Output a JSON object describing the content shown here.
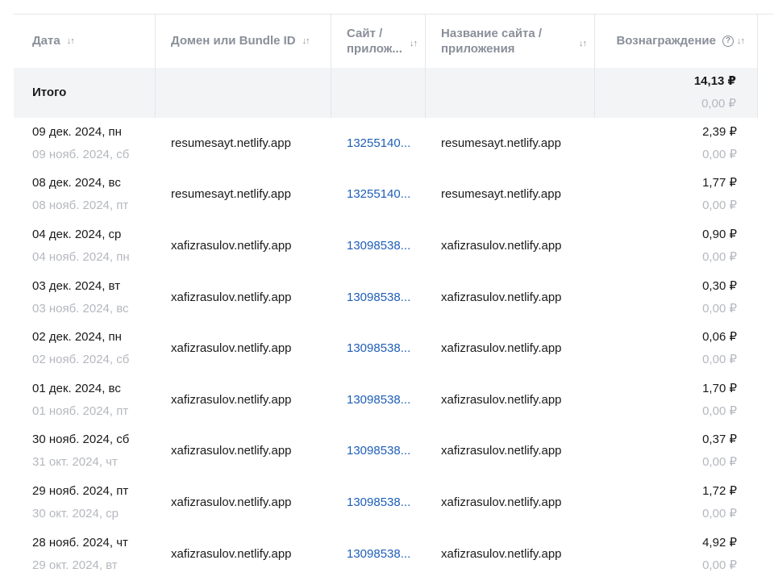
{
  "columns": {
    "date": "Дата",
    "domain": "Домен или Bundle ID",
    "site": "Сайт / прилож...",
    "name": "Название сайта / приложения",
    "reward": "Вознаграждение"
  },
  "icons": {
    "sort": "sort-arrows-icon",
    "help": "help-circle-icon"
  },
  "total": {
    "label": "Итого",
    "amount": "14,13 ₽",
    "compare": "0,00 ₽"
  },
  "colors": {
    "link": "#1e5eb8",
    "muted": "#b5b8bf",
    "total_bg": "#f3f4f6"
  },
  "rows": [
    {
      "date": "09 дек. 2024, пн",
      "compare_date": "09 нояб. 2024, сб",
      "domain": "resumesayt.netlify.app",
      "site": "13255140...",
      "name": "resumesayt.netlify.app",
      "amount": "2,39 ₽",
      "compare": "0,00 ₽"
    },
    {
      "date": "08 дек. 2024, вс",
      "compare_date": "08 нояб. 2024, пт",
      "domain": "resumesayt.netlify.app",
      "site": "13255140...",
      "name": "resumesayt.netlify.app",
      "amount": "1,77 ₽",
      "compare": "0,00 ₽"
    },
    {
      "date": "04 дек. 2024, ср",
      "compare_date": "04 нояб. 2024, пн",
      "domain": "xafizrasulov.netlify.app",
      "site": "13098538...",
      "name": "xafizrasulov.netlify.app",
      "amount": "0,90 ₽",
      "compare": "0,00 ₽"
    },
    {
      "date": "03 дек. 2024, вт",
      "compare_date": "03 нояб. 2024, вс",
      "domain": "xafizrasulov.netlify.app",
      "site": "13098538...",
      "name": "xafizrasulov.netlify.app",
      "amount": "0,30 ₽",
      "compare": "0,00 ₽"
    },
    {
      "date": "02 дек. 2024, пн",
      "compare_date": "02 нояб. 2024, сб",
      "domain": "xafizrasulov.netlify.app",
      "site": "13098538...",
      "name": "xafizrasulov.netlify.app",
      "amount": "0,06 ₽",
      "compare": "0,00 ₽"
    },
    {
      "date": "01 дек. 2024, вс",
      "compare_date": "01 нояб. 2024, пт",
      "domain": "xafizrasulov.netlify.app",
      "site": "13098538...",
      "name": "xafizrasulov.netlify.app",
      "amount": "1,70 ₽",
      "compare": "0,00 ₽"
    },
    {
      "date": "30 нояб. 2024, сб",
      "compare_date": "31 окт. 2024, чт",
      "domain": "xafizrasulov.netlify.app",
      "site": "13098538...",
      "name": "xafizrasulov.netlify.app",
      "amount": "0,37 ₽",
      "compare": "0,00 ₽"
    },
    {
      "date": "29 нояб. 2024, пт",
      "compare_date": "30 окт. 2024, ср",
      "domain": "xafizrasulov.netlify.app",
      "site": "13098538...",
      "name": "xafizrasulov.netlify.app",
      "amount": "1,72 ₽",
      "compare": "0,00 ₽"
    },
    {
      "date": "28 нояб. 2024, чт",
      "compare_date": "29 окт. 2024, вт",
      "domain": "xafizrasulov.netlify.app",
      "site": "13098538...",
      "name": "xafizrasulov.netlify.app",
      "amount": "4,92 ₽",
      "compare": "0,00 ₽"
    }
  ]
}
